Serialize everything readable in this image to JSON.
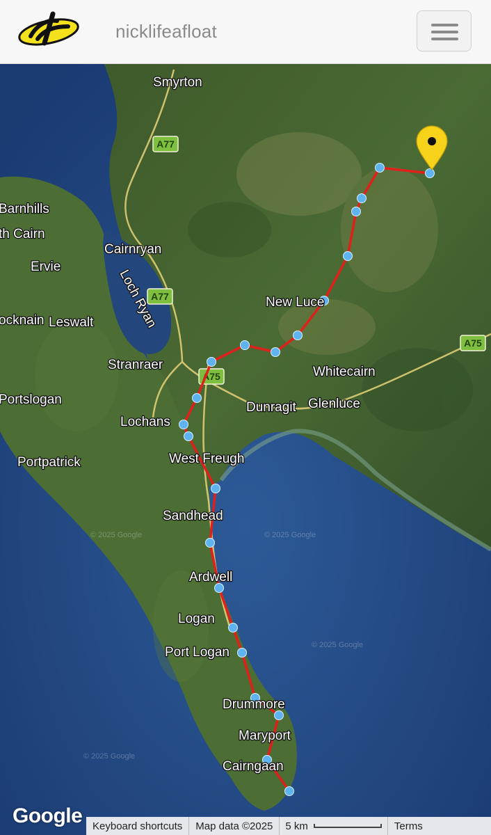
{
  "header": {
    "site_title": "nicklifeafloat",
    "logo_icon": "yb-logo-icon",
    "menu_icon": "hamburger-menu-icon",
    "menu_label": "Menu"
  },
  "map": {
    "places": {
      "smyrton": "Smyrton",
      "barnhills": "Barnhills",
      "north_cairn": "th Cairn",
      "ervie": "Ervie",
      "cairnryan": "Cairnryan",
      "loch_ryan": "Loch Ryan",
      "new_luce": "New Luce",
      "knocknain": "ocknain",
      "leswalt": "Leswalt",
      "stranraer": "Stranraer",
      "whitecairn": "Whitecairn",
      "portslogan": "Portslogan",
      "dunragit": "Dunragit",
      "glenluce": "Glenluce",
      "lochans": "Lochans",
      "portpatrick": "Portpatrick",
      "west_freugh": "West Freugh",
      "sandhead": "Sandhead",
      "ardwell": "Ardwell",
      "logan": "Logan",
      "port_logan": "Port Logan",
      "drummore": "Drummore",
      "maryport": "Maryport",
      "cairngaan": "Cairngaan"
    },
    "roads": {
      "a77_north": "A77",
      "a77_loch": "A77",
      "a75_stranraer": "A75",
      "a75_east": "A75"
    },
    "watermark": "© 2025 Google",
    "route_color": "#e0201b",
    "waypoint_color": "#5fb4f0",
    "pin_color": "#f6d21a",
    "pin_icon": "map-pin-icon"
  },
  "footer": {
    "google_logo": "Google",
    "keyboard_shortcuts": "Keyboard shortcuts",
    "map_data": "Map data ©2025",
    "scale_label": "5 km",
    "terms": "Terms"
  }
}
